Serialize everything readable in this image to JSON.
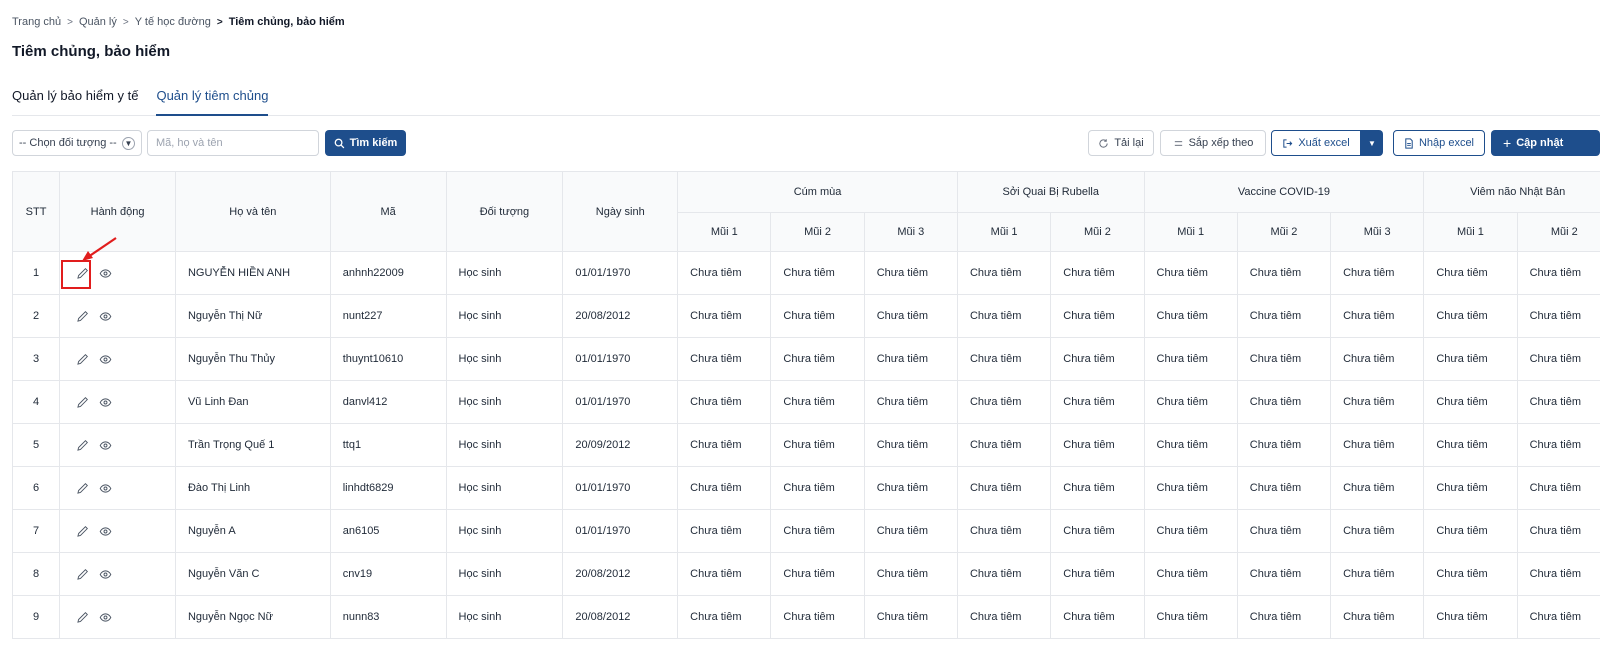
{
  "breadcrumb": {
    "items": [
      "Trang chủ",
      "Quản lý",
      "Y tế học đường",
      "Tiêm chủng, bảo hiểm"
    ]
  },
  "page": {
    "title": "Tiêm chủng, bảo hiểm"
  },
  "tabs": [
    {
      "label": "Quản lý bảo hiểm y tế",
      "active": false
    },
    {
      "label": "Quản lý tiêm chủng",
      "active": true
    }
  ],
  "toolbar": {
    "filter_select": "-- Chọn đối tượng --",
    "search_placeholder": "Mã, họ và tên",
    "search_button": "Tìm kiếm",
    "reload_button": "Tải lại",
    "sort_button": "Sắp xếp theo",
    "export_button": "Xuất excel",
    "import_button": "Nhập excel",
    "update_button": "Cập nhật"
  },
  "table": {
    "headers": {
      "stt": "STT",
      "actions": "Hành động",
      "name": "Họ và tên",
      "code": "Mã",
      "group": "Đối tượng",
      "dob": "Ngày sinh"
    },
    "vaccines": [
      {
        "name": "Cúm mùa",
        "doses": [
          "Mũi 1",
          "Mũi 2",
          "Mũi 3"
        ]
      },
      {
        "name": "Sởi Quai Bị Rubella",
        "doses": [
          "Mũi 1",
          "Mũi 2"
        ]
      },
      {
        "name": "Vaccine COVID-19",
        "doses": [
          "Mũi 1",
          "Mũi 2",
          "Mũi 3"
        ]
      },
      {
        "name": "Viêm não Nhật Bản",
        "doses": [
          "Mũi 1",
          "Mũi 2"
        ]
      }
    ],
    "rows": [
      {
        "stt": "1",
        "name": "NGUYỄN HIỀN ANH",
        "code": "anhnh22009",
        "group": "Học sinh",
        "dob": "01/01/1970",
        "doses": [
          "Chưa tiêm",
          "Chưa tiêm",
          "Chưa tiêm",
          "Chưa tiêm",
          "Chưa tiêm",
          "Chưa tiêm",
          "Chưa tiêm",
          "Chưa tiêm",
          "Chưa tiêm",
          "Chưa tiêm"
        ]
      },
      {
        "stt": "2",
        "name": "Nguyễn Thị Nữ",
        "code": "nunt227",
        "group": "Học sinh",
        "dob": "20/08/2012",
        "doses": [
          "Chưa tiêm",
          "Chưa tiêm",
          "Chưa tiêm",
          "Chưa tiêm",
          "Chưa tiêm",
          "Chưa tiêm",
          "Chưa tiêm",
          "Chưa tiêm",
          "Chưa tiêm",
          "Chưa tiêm"
        ]
      },
      {
        "stt": "3",
        "name": "Nguyễn Thu Thủy",
        "code": "thuynt10610",
        "group": "Học sinh",
        "dob": "01/01/1970",
        "doses": [
          "Chưa tiêm",
          "Chưa tiêm",
          "Chưa tiêm",
          "Chưa tiêm",
          "Chưa tiêm",
          "Chưa tiêm",
          "Chưa tiêm",
          "Chưa tiêm",
          "Chưa tiêm",
          "Chưa tiêm"
        ]
      },
      {
        "stt": "4",
        "name": "Vũ Linh Đan",
        "code": "danvl412",
        "group": "Học sinh",
        "dob": "01/01/1970",
        "doses": [
          "Chưa tiêm",
          "Chưa tiêm",
          "Chưa tiêm",
          "Chưa tiêm",
          "Chưa tiêm",
          "Chưa tiêm",
          "Chưa tiêm",
          "Chưa tiêm",
          "Chưa tiêm",
          "Chưa tiêm"
        ]
      },
      {
        "stt": "5",
        "name": "Trần Trọng Quế 1",
        "code": "ttq1",
        "group": "Học sinh",
        "dob": "20/09/2012",
        "doses": [
          "Chưa tiêm",
          "Chưa tiêm",
          "Chưa tiêm",
          "Chưa tiêm",
          "Chưa tiêm",
          "Chưa tiêm",
          "Chưa tiêm",
          "Chưa tiêm",
          "Chưa tiêm",
          "Chưa tiêm"
        ]
      },
      {
        "stt": "6",
        "name": "Đào Thị Linh",
        "code": "linhdt6829",
        "group": "Học sinh",
        "dob": "01/01/1970",
        "doses": [
          "Chưa tiêm",
          "Chưa tiêm",
          "Chưa tiêm",
          "Chưa tiêm",
          "Chưa tiêm",
          "Chưa tiêm",
          "Chưa tiêm",
          "Chưa tiêm",
          "Chưa tiêm",
          "Chưa tiêm"
        ]
      },
      {
        "stt": "7",
        "name": "Nguyễn A",
        "code": "an6105",
        "group": "Học sinh",
        "dob": "01/01/1970",
        "doses": [
          "Chưa tiêm",
          "Chưa tiêm",
          "Chưa tiêm",
          "Chưa tiêm",
          "Chưa tiêm",
          "Chưa tiêm",
          "Chưa tiêm",
          "Chưa tiêm",
          "Chưa tiêm",
          "Chưa tiêm"
        ]
      },
      {
        "stt": "8",
        "name": "Nguyễn Văn C",
        "code": "cnv19",
        "group": "Học sinh",
        "dob": "20/08/2012",
        "doses": [
          "Chưa tiêm",
          "Chưa tiêm",
          "Chưa tiêm",
          "Chưa tiêm",
          "Chưa tiêm",
          "Chưa tiêm",
          "Chưa tiêm",
          "Chưa tiêm",
          "Chưa tiêm",
          "Chưa tiêm"
        ]
      },
      {
        "stt": "9",
        "name": "Nguyễn Ngọc Nữ",
        "code": "nunn83",
        "group": "Học sinh",
        "dob": "20/08/2012",
        "doses": [
          "Chưa tiêm",
          "Chưa tiêm",
          "Chưa tiêm",
          "Chưa tiêm",
          "Chưa tiêm",
          "Chưa tiêm",
          "Chưa tiêm",
          "Chưa tiêm",
          "Chưa tiêm",
          "Chưa tiêm"
        ]
      }
    ]
  },
  "colors": {
    "primary": "#1e4e8c",
    "annotation": "#e11d1d",
    "border": "#e5e7eb"
  }
}
